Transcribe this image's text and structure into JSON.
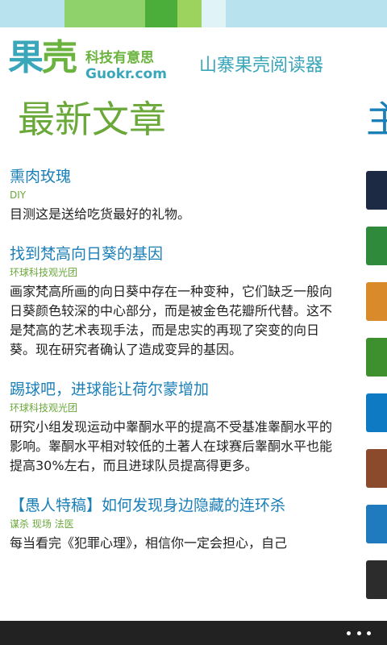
{
  "header": {
    "logo_main_1": "果",
    "logo_main_2": "壳",
    "logo_tagline": "科技有意思",
    "logo_url": "Guokr.com",
    "app_title": "山寨果壳阅读器"
  },
  "section": {
    "title": "最新文章",
    "next_title": "主"
  },
  "articles": [
    {
      "title": "熏肉玫瑰",
      "tag": "DIY",
      "summary": "目测这是送给吃货最好的礼物。"
    },
    {
      "title": "找到梵高向日葵的基因",
      "tag": "环球科技观光团",
      "summary": "画家梵高所画的向日葵中存在一种变种，它们缺乏一般向日葵颜色较深的中心部分，而是被金色花瓣所代替。这不是梵高的艺术表现手法，而是忠实的再现了突变的向日葵。现在研究者确认了造成变异的基因。"
    },
    {
      "title": "踢球吧，进球能让荷尔蒙增加",
      "tag": "环球科技观光团",
      "summary": "研究小组发现运动中睾酮水平的提高不受基准睾酮水平的影响。睾酮水平相对较低的土著人在球赛后睾酮水平也能提高30%左右，而且进球队员提高得更多。"
    },
    {
      "title": "【愚人特稿】如何发现身边隐藏的连环杀",
      "tag": "谋杀 现场 法医",
      "summary": "每当看完《犯罪心理》，相信你一定会担心，自己"
    }
  ],
  "thumbs": [
    "#1d2a44",
    "#2f8a3c",
    "#d98a2b",
    "#3e8f2e",
    "#0f7ac4",
    "#8b4a2b",
    "#1f7bbd",
    "#2c2c2c"
  ],
  "appbar": {
    "more_icon": "ellipsis-icon"
  },
  "colors": {
    "accent_blue": "#1b7fb8",
    "accent_green": "#6aa83a",
    "logo_teal": "#3aa6b9"
  }
}
